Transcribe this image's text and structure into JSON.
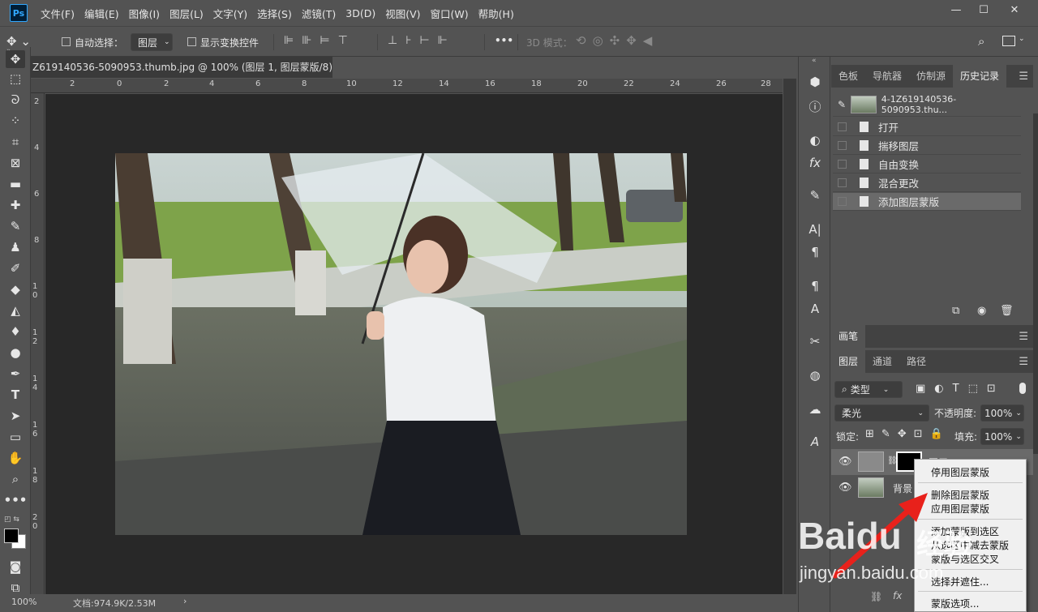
{
  "app": {
    "logo_text": "Ps"
  },
  "menu": [
    "文件(F)",
    "编辑(E)",
    "图像(I)",
    "图层(L)",
    "文字(Y)",
    "选择(S)",
    "滤镜(T)",
    "3D(D)",
    "视图(V)",
    "窗口(W)",
    "帮助(H)"
  ],
  "window_controls": {
    "minimize": "—",
    "restore": "☐",
    "close": "✕"
  },
  "options": {
    "auto_select_label": "自动选择：",
    "auto_select_target": "图层",
    "show_transform_label": "显示变换控件",
    "more": "•••",
    "mode_3d_label": "3D 模式："
  },
  "document": {
    "tab_title": "Z619140536-5090953.thumb.jpg @ 100% (图层 1, 图层蒙版/8) *",
    "tab_close": "×",
    "ruler_h": [
      "2",
      "0",
      "2",
      "4",
      "6",
      "8",
      "10",
      "12",
      "14",
      "16",
      "18",
      "20",
      "22",
      "24",
      "26",
      "28"
    ],
    "ruler_v": [
      "2",
      "4",
      "6",
      "8",
      "1 0",
      "1 2",
      "1 4",
      "1 6",
      "1 8",
      "2 0"
    ],
    "zoom": "100%",
    "doc_info": "文档:974.9K/2.53M",
    "status_arrow": "›"
  },
  "history_panel": {
    "tabs": [
      "色板",
      "导航器",
      "仿制源",
      "历史记录"
    ],
    "active_tab": "历史记录",
    "snapshot_name": "4-1Z619140536-5090953.thu...",
    "items": [
      "打开",
      "揣移图层",
      "自由变换",
      "混合更改",
      "添加图层蒙版"
    ]
  },
  "brush_panel": {
    "tab": "画笔"
  },
  "layers_panel": {
    "tabs": [
      "图层",
      "通道",
      "路径"
    ],
    "active_tab": "图层",
    "filter_label": "类型",
    "blend_mode": "柔光",
    "opacity_label": "不透明度:",
    "opacity": "100%",
    "lock_label": "锁定:",
    "fill_label": "填充:",
    "fill": "100%",
    "layers": [
      {
        "name": "图层 1"
      },
      {
        "name": "背景"
      }
    ],
    "fx_label": "fx"
  },
  "context_menu": {
    "items": [
      "停用图层蒙版",
      "删除图层蒙版",
      "应用图层蒙版",
      "添加蒙版到选区",
      "从选区中减去蒙版",
      "蒙版与选区交叉",
      "选择并遮住...",
      "蒙版选项..."
    ]
  },
  "watermark": {
    "brand": "Baidu",
    "brand_cn": "经验",
    "url": "jingyan.baidu.com"
  },
  "colors": {
    "accent_ps": "#31a8ff",
    "arrow": "#e8211b",
    "watermark": "#ffffff"
  }
}
